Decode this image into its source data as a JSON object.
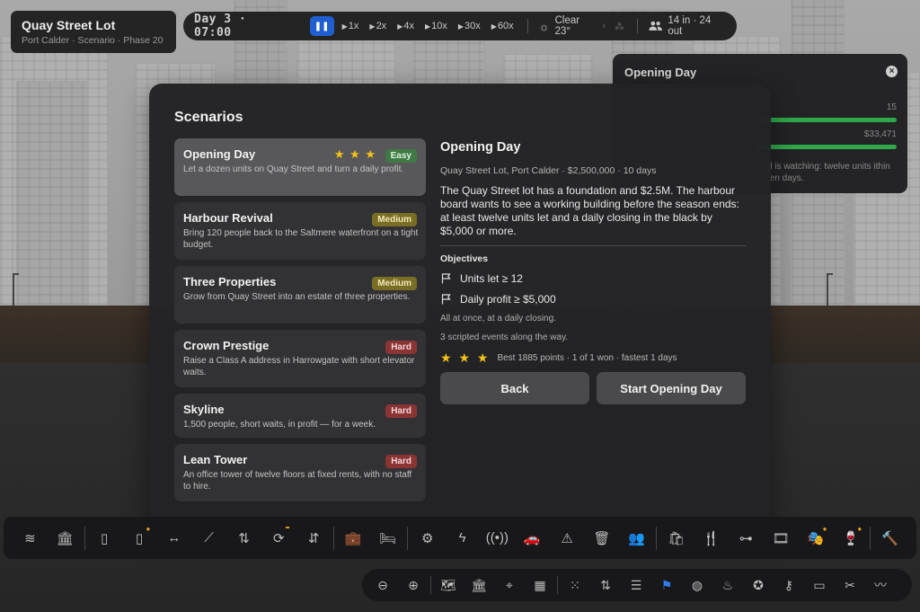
{
  "lot": {
    "title": "Quay Street Lot",
    "subtitle": "Port Calder · Scenario · Phase 20"
  },
  "topbar": {
    "day": "Day 3 · 07:00",
    "pause_icon": "pause-icon",
    "speeds": [
      "1x",
      "2x",
      "4x",
      "10x",
      "30x",
      "60x"
    ],
    "weather": "Clear 23°",
    "people": "14 in · 24 out"
  },
  "side_panel": {
    "title": "Opening Day",
    "value1": "15",
    "value2": "$33,471",
    "note": "d is watching: twelve units ithin ten days.",
    "progress1": 1.0,
    "progress2": 1.0,
    "bar_color": "#2fa84a"
  },
  "modal": {
    "title": "Scenarios",
    "scenarios": [
      {
        "name": "Opening Day",
        "desc": "Let a dozen units on Quay Street and turn a daily profit.",
        "difficulty": "Easy",
        "stars": "★ ★ ★",
        "stars_earned": 3,
        "selected": true
      },
      {
        "name": "Harbour Revival",
        "desc": "Bring 120 people back to the Saltmere waterfront on a tight budget.",
        "difficulty": "Medium"
      },
      {
        "name": "Three Properties",
        "desc": "Grow from Quay Street into an estate of three properties.",
        "difficulty": "Medium"
      },
      {
        "name": "Crown Prestige",
        "desc": "Raise a Class A address in Harrowgate with short elevator waits.",
        "difficulty": "Hard"
      },
      {
        "name": "Skyline",
        "desc": "1,500 people, short waits, in profit — for a week.",
        "difficulty": "Hard"
      },
      {
        "name": "Lean Tower",
        "desc": "An office tower of twelve floors at fixed rents, with no staff to hire.",
        "difficulty": "Hard"
      }
    ],
    "detail": {
      "title": "Opening Day",
      "meta": "Quay Street Lot, Port Calder · $2,500,000 · 10 days",
      "body": "The Quay Street lot has a foundation and $2.5M. The harbour board wants to see a working building before the season ends: at least twelve units let and a daily closing in the black by $5,000 or more.",
      "objectives_heading": "Objectives",
      "objectives": [
        "Units let ≥ 12",
        "Daily profit ≥ $5,000"
      ],
      "note1": "All at once, at a daily closing.",
      "note2": "3 scripted events along the way.",
      "best_stars": "★ ★ ★",
      "best": "Best 1885 points · 1 of 1 won · fastest 1 days",
      "back_label": "Back",
      "start_label": "Start Opening Day"
    }
  },
  "colors": {
    "accent": "#1f5fd0",
    "star": "#f2c21a",
    "easy": "#3f7a45",
    "medium": "#7a6d25",
    "hard": "#8a3434"
  },
  "build_tools": [
    "layers-icon",
    "bank-icon",
    "|",
    "door-icon",
    "door-locked-icon",
    "arrows-horizontal-icon",
    "stairs-icon",
    "elevator-icon",
    "escalator-icon",
    "elevator-express-icon",
    "|",
    "briefcase-icon",
    "bed-icon",
    "|",
    "gears-icon",
    "lightning-icon",
    "antenna-icon",
    "car-icon",
    "warning-icon",
    "trash-icon",
    "people-icon",
    "|",
    "shopping-bag-icon",
    "fork-knife-icon",
    "dumbbell-icon",
    "film-icon",
    "theater-masks-icon",
    "wine-glass-icon",
    "|",
    "hammer-icon"
  ],
  "view_tools": [
    "zoom-out-icon",
    "zoom-in-icon",
    "|",
    "map-icon",
    "bank-icon",
    "crosshair-icon",
    "building-icon",
    "|",
    "grid-icon",
    "sort-arrows-icon",
    "sliders-icon",
    "flag-icon",
    "globe-icon",
    "flame-icon",
    "award-icon",
    "key-icon",
    "cash-icon",
    "tools-icon",
    "trend-icon"
  ]
}
